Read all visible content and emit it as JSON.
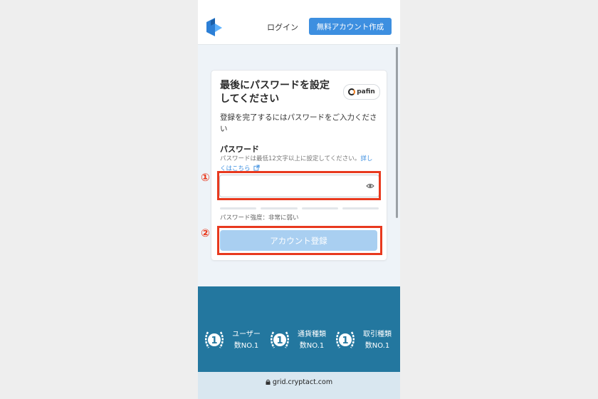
{
  "header": {
    "login_label": "ログイン",
    "signup_label": "無料アカウント作成"
  },
  "card": {
    "title": "最後にパスワードを設定してください",
    "partner_logo_text": "pafin",
    "instruction": "登録を完了するにはパスワードをご入力ください",
    "password": {
      "label": "パスワード",
      "hint": "パスワードは最低12文字以上に設定してください。",
      "hint_link": "詳しくはこちら",
      "value": "",
      "strength_text": "パスワード強度：非常に弱い",
      "strength_level": 0
    },
    "submit_label": "アカウント登録"
  },
  "annotations": {
    "marker_1": "①",
    "marker_2": "②",
    "color": "#e8391e"
  },
  "banner": {
    "stats": [
      {
        "badge": "1",
        "line1": "ユーザー",
        "line2": "数NO.1"
      },
      {
        "badge": "1",
        "line1": "通貨種類",
        "line2": "数NO.1"
      },
      {
        "badge": "1",
        "line1": "取引種類",
        "line2": "数NO.1"
      }
    ]
  },
  "browser": {
    "url": "grid.cryptact.com"
  },
  "colors": {
    "brand_blue": "#3d8fe0",
    "button_disabled": "#a9cff1",
    "banner": "#23779f"
  },
  "icons": [
    "cryptact-logo",
    "eye-icon",
    "external-link-icon",
    "lock-icon",
    "laurel-badge-icon"
  ]
}
